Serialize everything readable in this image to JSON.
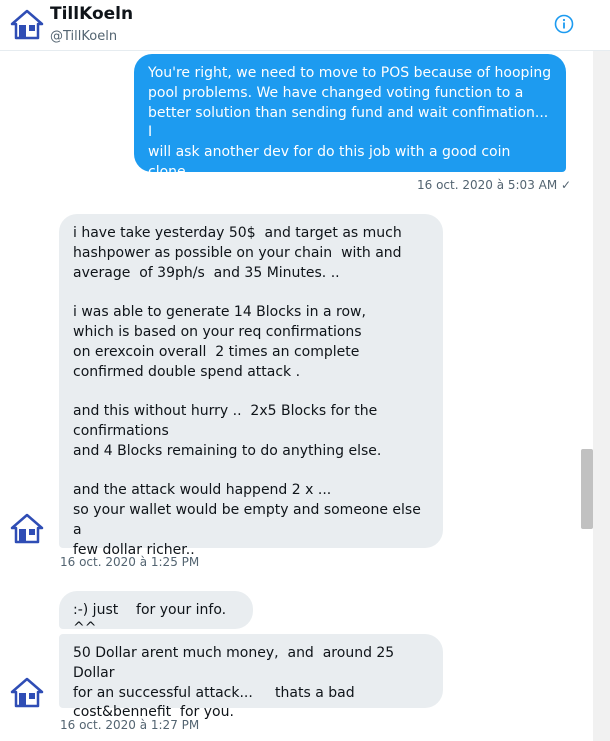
{
  "header": {
    "name": "TillKoeln",
    "handle": "@TillKoeln"
  },
  "messages": [
    {
      "direction": "outgoing",
      "text": "You're right, we need to move to POS because of hooping\npool problems. We have changed voting function to a\nbetter solution than sending fund and wait confimation... I\nwill ask another dev for do this job with a good coin clone.\nThank you very much for you advices",
      "timestamp": "16 oct. 2020 à 5:03 AM",
      "status": "✓"
    },
    {
      "direction": "incoming",
      "text": "i have take yesterday 50$  and target as much\nhashpower as possible on your chain  with and\naverage  of 39ph/s  and 35 Minutes. ..\n\ni was able to generate 14 Blocks in a row,\nwhich is based on your req confirmations\non erexcoin overall  2 times an complete\nconfirmed double spend attack .\n\nand this without hurry ..  2x5 Blocks for the\nconfirmations\nand 4 Blocks remaining to do anything else.\n\nand the attack would happend 2 x ...\nso your wallet would be empty and someone else a\nfew dollar richer..",
      "timestamp": "16 oct. 2020 à 1:25 PM"
    },
    {
      "direction": "incoming",
      "text": ":-) just    for your info. ^^"
    },
    {
      "direction": "incoming",
      "text": "50 Dollar arent much money,  and  around 25 Dollar\nfor an successful attack...     thats a bad\ncost&bennefit  for you.",
      "timestamp": "16 oct. 2020 à 1:27 PM"
    }
  ],
  "icons": {
    "avatar": "house-avatar-icon",
    "info": "info-icon"
  },
  "colors": {
    "accent": "#1d9bf0",
    "incoming_bubble": "#e9edf0",
    "avatar_blue": "#2f4db5"
  }
}
